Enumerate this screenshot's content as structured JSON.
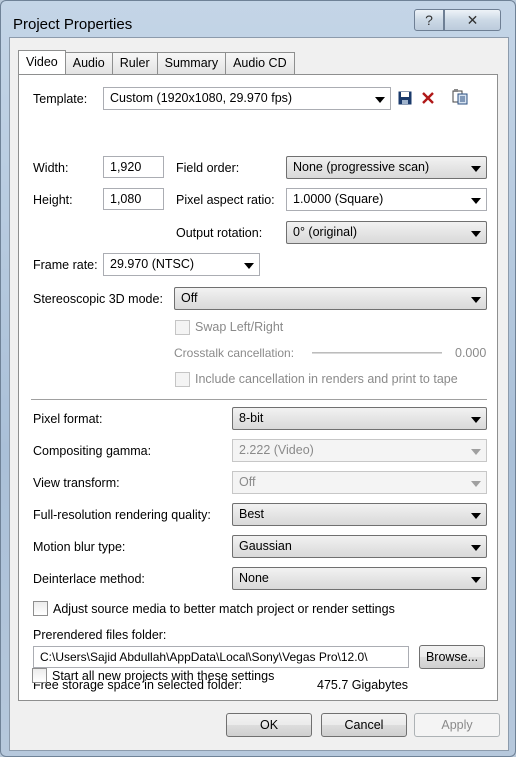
{
  "window": {
    "title": "Project Properties"
  },
  "tabs": [
    "Video",
    "Audio",
    "Ruler",
    "Summary",
    "Audio CD"
  ],
  "video": {
    "template_label": "Template:",
    "template_value": "Custom (1920x1080, 29.970 fps)",
    "width_label": "Width:",
    "width_value": "1,920",
    "height_label": "Height:",
    "height_value": "1,080",
    "field_order_label": "Field order:",
    "field_order_value": "None (progressive scan)",
    "pixel_aspect_label": "Pixel aspect ratio:",
    "pixel_aspect_value": "1.0000 (Square)",
    "output_rotation_label": "Output rotation:",
    "output_rotation_value": "0° (original)",
    "frame_rate_label": "Frame rate:",
    "frame_rate_value": "29.970 (NTSC)",
    "stereo_label": "Stereoscopic 3D mode:",
    "stereo_value": "Off",
    "swap_label": "Swap Left/Right",
    "crosstalk_label": "Crosstalk cancellation:",
    "crosstalk_value": "0.000",
    "include_cancel_label": "Include cancellation in renders and print to tape",
    "pixel_format_label": "Pixel format:",
    "pixel_format_value": "8-bit",
    "gamma_label": "Compositing gamma:",
    "gamma_value": "2.222 (Video)",
    "view_transform_label": "View transform:",
    "view_transform_value": "Off",
    "render_quality_label": "Full-resolution rendering quality:",
    "render_quality_value": "Best",
    "motion_blur_label": "Motion blur type:",
    "motion_blur_value": "Gaussian",
    "deinterlace_label": "Deinterlace method:",
    "deinterlace_value": "None",
    "adjust_label": "Adjust source media to better match project or render settings",
    "prerender_label": "Prerendered files folder:",
    "prerender_path": "C:\\Users\\Sajid Abdullah\\AppData\\Local\\Sony\\Vegas Pro\\12.0\\",
    "browse_label": "Browse...",
    "free_space_label": "Free storage space in selected folder:",
    "free_space_value": "475.7 Gigabytes",
    "start_all_label": "Start all new projects with these settings"
  },
  "buttons": {
    "ok": "OK",
    "cancel": "Cancel",
    "apply": "Apply"
  },
  "icons": {
    "help": "?",
    "close": "✕"
  },
  "colors": {
    "window_frame": "#b9c9da",
    "delete_icon": "#b01818",
    "save_icon": "#1a3a6b"
  }
}
